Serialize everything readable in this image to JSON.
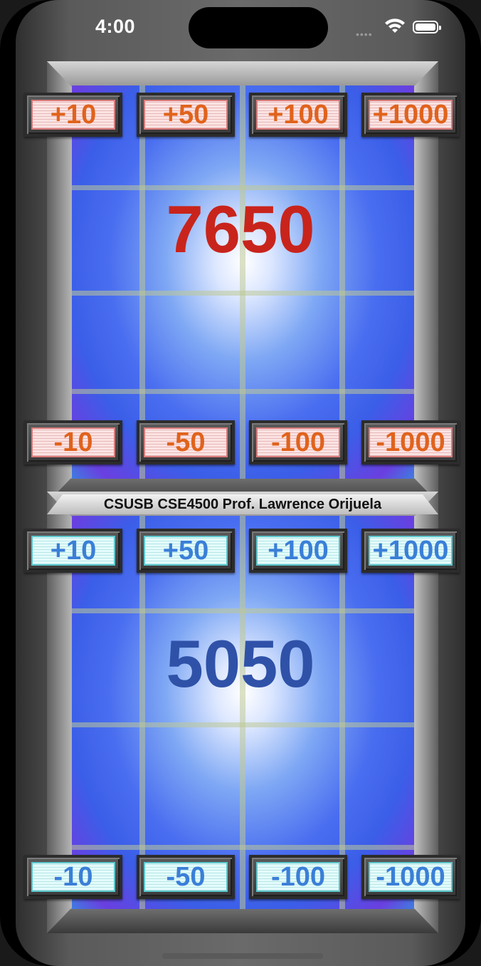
{
  "status": {
    "time": "4:00"
  },
  "top_panel": {
    "score": "7650",
    "increment_buttons": [
      "+10",
      "+50",
      "+100",
      "+1000"
    ],
    "decrement_buttons": [
      "-10",
      "-50",
      "-100",
      "-1000"
    ],
    "accent_color": "#c8241c",
    "button_text_color": "#e0631c"
  },
  "caption": "CSUSB CSE4500 Prof. Lawrence Orijuela",
  "bottom_panel": {
    "score": "5050",
    "increment_buttons": [
      "+10",
      "+50",
      "+100",
      "+1000"
    ],
    "decrement_buttons": [
      "-10",
      "-50",
      "-100",
      "-1000"
    ],
    "accent_color": "#2f52a8",
    "button_text_color": "#3a7fd8"
  }
}
